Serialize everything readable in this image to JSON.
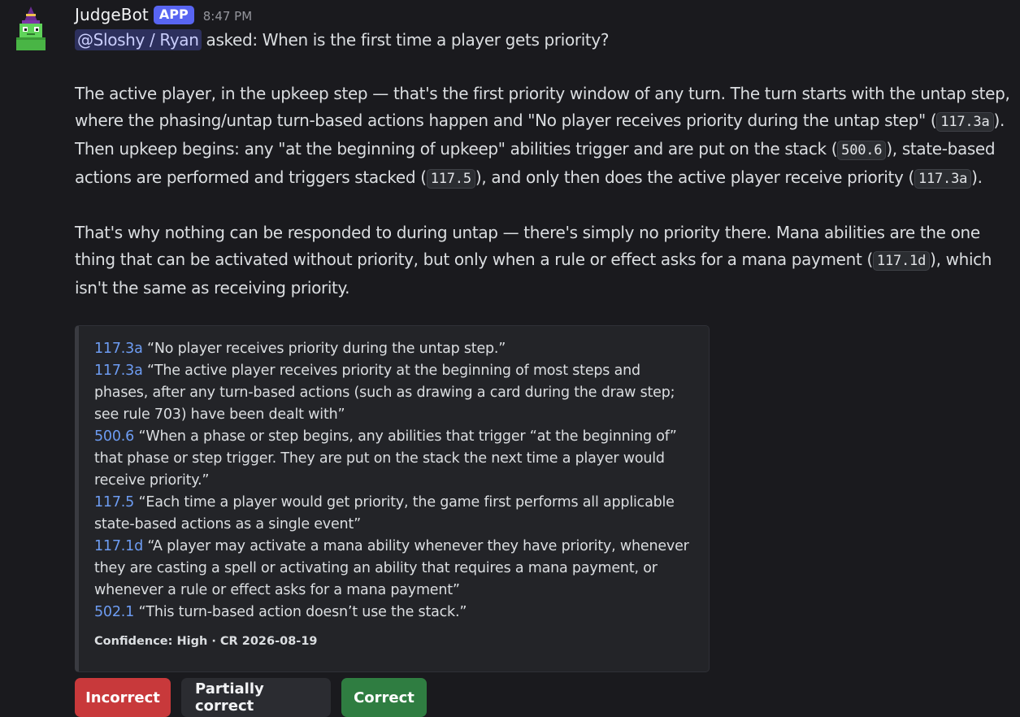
{
  "message": {
    "author": "JudgeBot",
    "badge": "APP",
    "timestamp": "8:47 PM",
    "mention": "@Sloshy / Ryan",
    "question_suffix": " asked: When is the first time a player gets priority?",
    "para1": {
      "t1": "The active player, in the upkeep step — that's the first priority window of any turn. The turn starts with the untap step, where the phasing/untap turn-based actions happen and \"No player receives priority during the untap step\" (",
      "c1": "117.3a",
      "t2": "). Then upkeep begins: any \"at the beginning of upkeep\" abilities trigger and are put on the stack (",
      "c2": "500.6",
      "t3": "), state-based actions are performed and triggers stacked (",
      "c3": "117.5",
      "t4": "), and only then does the active player receive priority (",
      "c4": "117.3a",
      "t5": ")."
    },
    "para2": {
      "t1": "That's why nothing can be responded to during untap — there's simply no priority there. Mana abilities are the one thing that can be activated without priority, but only when a rule or effect asks for a mana payment (",
      "c1": "117.1d",
      "t2": "), which isn't the same as receiving priority."
    }
  },
  "embed": {
    "citations": [
      {
        "rule": "117.3a",
        "quote": " “No player receives priority during the untap step.”"
      },
      {
        "rule": "117.3a",
        "quote": " “The active player receives priority at the beginning of most steps and phases, after any turn-based actions (such as drawing a card during the draw step; see rule 703) have been dealt with”"
      },
      {
        "rule": "500.6",
        "quote": " “When a phase or step begins, any abilities that trigger “at the beginning of” that phase or step trigger. They are put on the stack the next time a player would receive priority.”"
      },
      {
        "rule": "117.5",
        "quote": " “Each time a player would get priority, the game first performs all applicable state-based actions as a single event”"
      },
      {
        "rule": "117.1d",
        "quote": " “A player may activate a mana ability whenever they have priority, whenever they are casting a spell or activating an ability that requires a mana payment, or whenever a rule or effect asks for a mana payment”"
      },
      {
        "rule": "502.1",
        "quote": " “This turn-based action doesn’t use the stack.”"
      }
    ],
    "footer": "Confidence: High · CR 2026-08-19"
  },
  "buttons": {
    "incorrect": "Incorrect",
    "partial": "Partially correct",
    "correct": "Correct"
  },
  "colors": {
    "background": "#1a1a1e",
    "badge": "#5865f2",
    "rule_link": "#6d9cf2",
    "danger": "#c8393b",
    "success": "#2f7d41",
    "secondary": "#2b2c31"
  },
  "icons": {
    "avatar": "green-wizard-robot-icon"
  }
}
